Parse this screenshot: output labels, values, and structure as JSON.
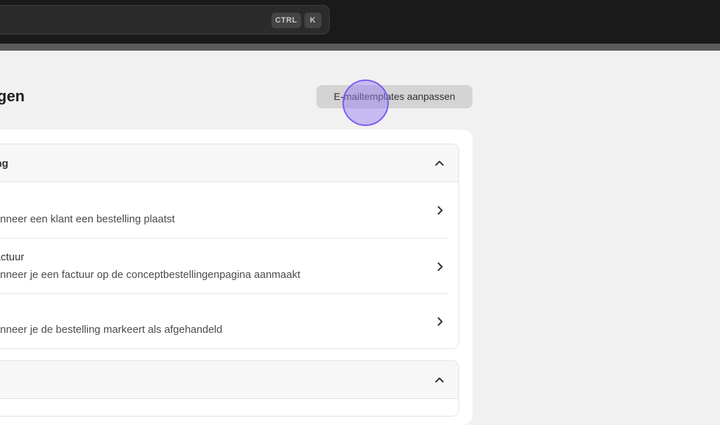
{
  "search": {
    "shortcut_ctrl": "CTRL",
    "shortcut_key": "K"
  },
  "page": {
    "title": "gen",
    "edit_templates_label": "E-mailtemplates aanpassen"
  },
  "sections": [
    {
      "title": "king",
      "items": [
        {
          "title": "",
          "description": "wanneer een klant een bestelling plaatst"
        },
        {
          "title": "sfactuur",
          "description": "wanneer je een factuur op de conceptbestellingenpagina aanmaakt"
        },
        {
          "title": "",
          "description": "wanneer je de bestelling markeert als afgehandeld"
        }
      ]
    },
    {
      "title": ""
    }
  ],
  "icons": {
    "collapse": "chevron-up-icon",
    "open_item": "chevron-right-icon"
  },
  "colors": {
    "topbar": "#1a1a1a",
    "background": "#f1f1f1",
    "cursor_highlight": "#7b5cf0"
  }
}
